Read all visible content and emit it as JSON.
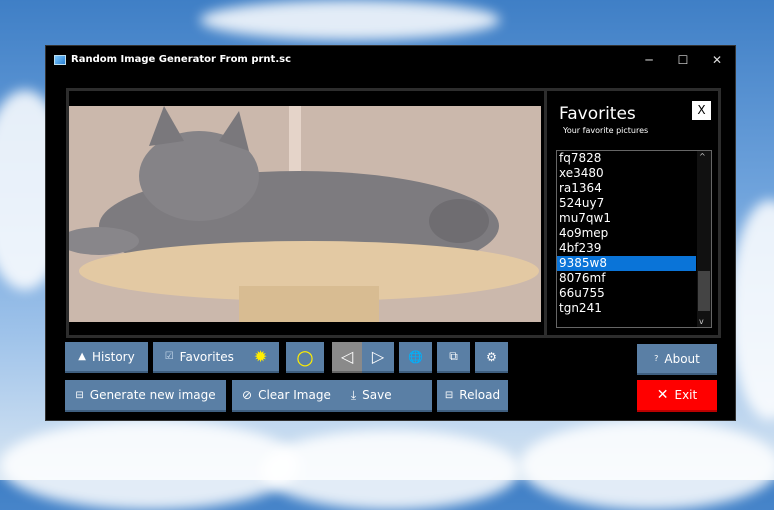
{
  "window": {
    "title": "Random Image Generator From prnt.sc",
    "minimize": "─",
    "maximize": "☐",
    "close": "✕"
  },
  "favorites": {
    "title": "Favorites",
    "subtitle": "Your favorite pictures",
    "close": "X",
    "items": [
      "fq7828",
      "xe3480",
      "ra1364",
      "524uy7",
      "mu7qw1",
      "4o9mep",
      "4bf239",
      "9385w8",
      "8076mf",
      "66u755",
      "tgn241"
    ],
    "selected": "9385w8"
  },
  "buttons": {
    "history": "History",
    "favorites": "Favorites",
    "generate": "Generate new image",
    "clear": "Clear Image",
    "save": "Save",
    "reload": "Reload",
    "about": "About",
    "exit": "Exit"
  },
  "icons": {
    "history": "▲",
    "favorites": "☑",
    "sun": "✹",
    "circle": "○",
    "prev": "◁",
    "next": "▷",
    "globe": "🌐",
    "copy": "⧉",
    "gear": "⚙",
    "generate": "⊟",
    "clear": "⃠",
    "save": "⤓",
    "reload": "⊟",
    "about": "?",
    "exit": "✕"
  },
  "colors": {
    "accent": "#5a7fa5",
    "exit": "#ff0000",
    "selection": "#0a74d8"
  }
}
